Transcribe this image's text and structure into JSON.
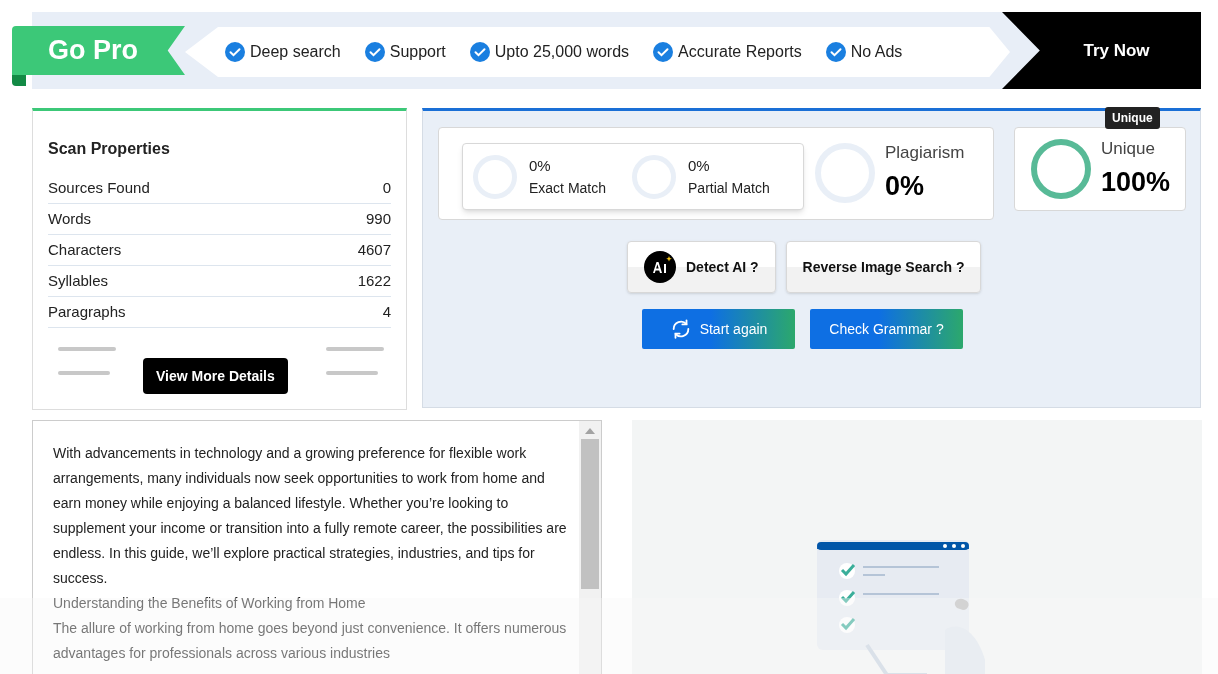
{
  "promo": {
    "badge": "Go Pro",
    "features": [
      "Deep search",
      "Support",
      "Upto 25,000 words",
      "Accurate Reports",
      "No Ads"
    ],
    "cta": "Try Now"
  },
  "scan_properties": {
    "title": "Scan Properties",
    "rows": [
      {
        "label": "Sources Found",
        "value": "0"
      },
      {
        "label": "Words",
        "value": "990"
      },
      {
        "label": "Characters",
        "value": "4607"
      },
      {
        "label": "Syllables",
        "value": "1622"
      },
      {
        "label": "Paragraphs",
        "value": "4"
      }
    ],
    "button": "View More Details"
  },
  "results": {
    "matches": [
      {
        "value": "0%",
        "label": "Exact Match"
      },
      {
        "value": "0%",
        "label": "Partial Match"
      }
    ],
    "plagiarism": {
      "label": "Plagiarism",
      "value": "0%"
    },
    "unique": {
      "label": "Unique",
      "value": "100%",
      "tooltip": "Unique"
    },
    "tools": [
      {
        "kind": "ai",
        "label": "Detect AI ?"
      },
      {
        "kind": "plain",
        "label": "Reverse Image Search ?"
      }
    ],
    "actions": [
      {
        "kind": "refresh",
        "label": "Start again"
      },
      {
        "kind": "plain",
        "label": "Check Grammar ?"
      }
    ]
  },
  "text_body": [
    "With advancements in technology and a growing preference for flexible work arrangements, many individuals now seek opportunities to work from home and earn money while enjoying a balanced lifestyle. Whether you’re looking to supplement your income or transition into a fully remote career, the possibilities are endless. In this guide, we’ll explore practical strategies, industries, and tips for success.",
    "Understanding the Benefits of Working from Home",
    "The allure of working from home goes beyond just convenience. It offers numerous advantages for professionals across various industries"
  ]
}
